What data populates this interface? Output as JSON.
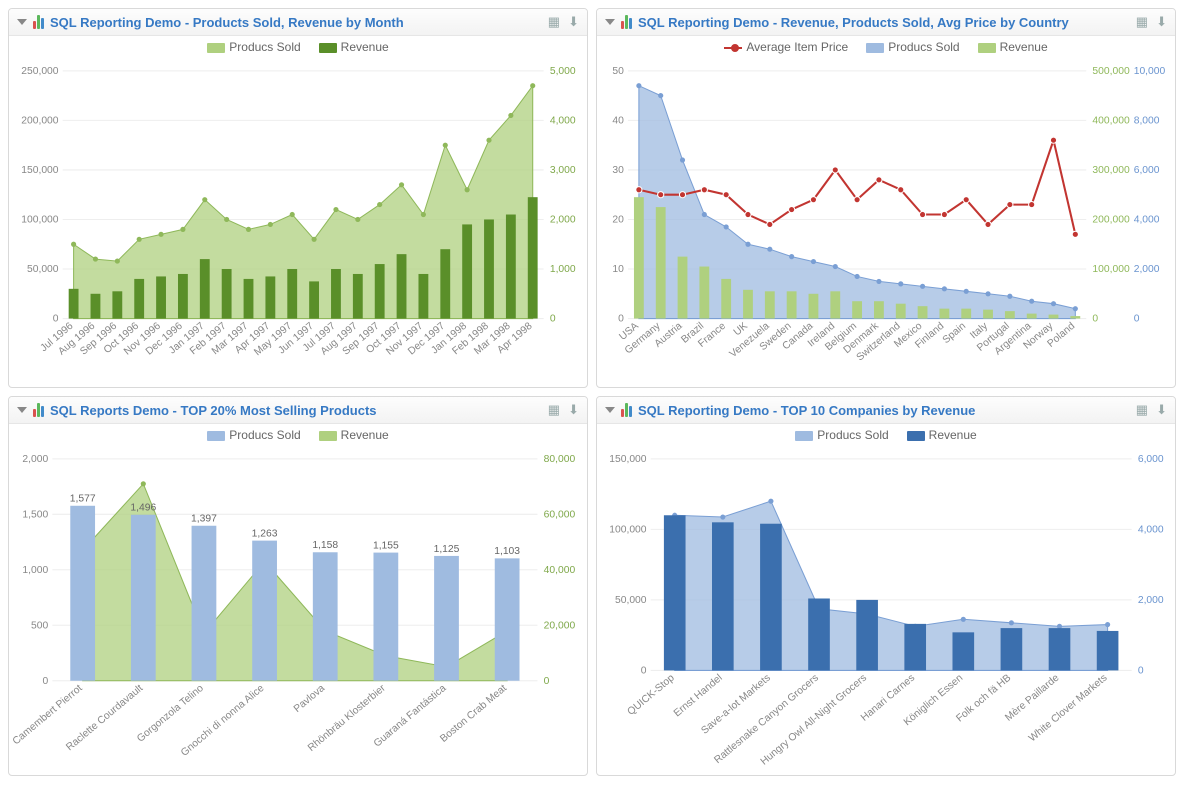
{
  "panels": [
    {
      "title": "SQL Reporting Demo - Products Sold, Revenue by Month"
    },
    {
      "title": "SQL Reporting Demo - Revenue, Products Sold, Avg Price by Country"
    },
    {
      "title": "SQL Reports Demo - TOP 20% Most Selling Products"
    },
    {
      "title": "SQL Reporting Demo - TOP 10 Companies by Revenue"
    }
  ],
  "legend_labels": {
    "products_sold": "Producs Sold",
    "revenue": "Revenue",
    "avg_price": "Average Item Price"
  },
  "colors": {
    "green_bar": "#5a8f29",
    "green_area": "#afd07f",
    "blue_bar": "#3b6fae",
    "blue_area": "#9fbbe0",
    "red_line": "#c23531"
  },
  "chart_data": [
    {
      "id": "revenue_by_month",
      "type": "bar+area",
      "categories": [
        "Jul 1996",
        "Aug 1996",
        "Sep 1996",
        "Oct 1996",
        "Nov 1996",
        "Dec 1996",
        "Jan 1997",
        "Feb 1997",
        "Mar 1997",
        "Apr 1997",
        "May 1997",
        "Jun 1997",
        "Jul 1997",
        "Aug 1997",
        "Sep 1997",
        "Oct 1997",
        "Nov 1997",
        "Dec 1997",
        "Jan 1998",
        "Feb 1998",
        "Mar 1998",
        "Apr 1998"
      ],
      "series": [
        {
          "name": "Producs Sold",
          "role": "area",
          "axis": "left",
          "values": [
            75000,
            60000,
            58000,
            80000,
            85000,
            90000,
            120000,
            100000,
            90000,
            95000,
            105000,
            80000,
            110000,
            100000,
            115000,
            135000,
            105000,
            175000,
            130000,
            180000,
            205000,
            235000
          ]
        },
        {
          "name": "Revenue",
          "role": "bar",
          "axis": "right",
          "values": [
            600,
            500,
            550,
            800,
            850,
            900,
            1200,
            1000,
            800,
            850,
            1000,
            750,
            1000,
            900,
            1100,
            1300,
            900,
            1400,
            1900,
            2000,
            2100,
            2450
          ]
        }
      ],
      "y_left": {
        "min": 0,
        "max": 250000,
        "ticks": [
          0,
          50000,
          100000,
          150000,
          200000,
          250000
        ]
      },
      "y_right": {
        "min": 0,
        "max": 5000,
        "ticks": [
          0,
          1000,
          2000,
          3000,
          4000,
          5000
        ]
      }
    },
    {
      "id": "by_country",
      "type": "bar+area+line",
      "categories": [
        "USA",
        "Germany",
        "Austria",
        "Brazil",
        "France",
        "UK",
        "Venezuela",
        "Sweden",
        "Canada",
        "Ireland",
        "Belgium",
        "Denmark",
        "Switzerland",
        "Mexico",
        "Finland",
        "Spain",
        "Italy",
        "Portugal",
        "Argentina",
        "Norway",
        "Poland"
      ],
      "series": [
        {
          "name": "Producs Sold",
          "role": "area",
          "axis": "right_blue",
          "values": [
            9400,
            9000,
            6400,
            4200,
            3700,
            3000,
            2800,
            2500,
            2300,
            2100,
            1700,
            1500,
            1400,
            1300,
            1200,
            1100,
            1000,
            900,
            700,
            600,
            400
          ]
        },
        {
          "name": "Revenue",
          "role": "bar",
          "axis": "right_green",
          "values": [
            245000,
            225000,
            125000,
            105000,
            80000,
            58000,
            55000,
            55000,
            50000,
            55000,
            35000,
            35000,
            30000,
            25000,
            20000,
            20000,
            18000,
            15000,
            10000,
            8000,
            5000
          ]
        },
        {
          "name": "Average Item Price",
          "role": "line",
          "axis": "left",
          "values": [
            26,
            25,
            25,
            26,
            25,
            21,
            19,
            22,
            24,
            30,
            24,
            28,
            26,
            21,
            21,
            24,
            19,
            23,
            23,
            36,
            17
          ]
        }
      ],
      "y_left": {
        "min": 0,
        "max": 50,
        "ticks": [
          0,
          10,
          20,
          30,
          40,
          50
        ]
      },
      "y_right_green": {
        "min": 0,
        "max": 500000,
        "ticks": [
          0,
          100000,
          200000,
          300000,
          400000,
          500000
        ]
      },
      "y_right_blue": {
        "min": 0,
        "max": 10000,
        "ticks": [
          0,
          2000,
          4000,
          6000,
          8000,
          10000
        ]
      }
    },
    {
      "id": "top_products",
      "type": "bar+area",
      "categories": [
        "Camembert Pierrot",
        "Raclette Courdavault",
        "Gorgonzola Telino",
        "Gnocchi di nonna Alice",
        "Pavlova",
        "Rhönbräu Klosterbier",
        "Guaraná Fantástica",
        "Boston Crab Meat"
      ],
      "series": [
        {
          "name": "Producs Sold",
          "role": "bar",
          "axis": "left",
          "values": [
            1577,
            1496,
            1397,
            1263,
            1158,
            1155,
            1125,
            1103
          ],
          "show_labels": true
        },
        {
          "name": "Revenue",
          "role": "area",
          "axis": "right",
          "values": [
            47000,
            71000,
            17000,
            43000,
            18000,
            9000,
            5000,
            18000
          ]
        }
      ],
      "y_left": {
        "min": 0,
        "max": 2000,
        "ticks": [
          0,
          500,
          1000,
          1500,
          2000
        ]
      },
      "y_right": {
        "min": 0,
        "max": 80000,
        "ticks": [
          0,
          20000,
          40000,
          60000,
          80000
        ]
      }
    },
    {
      "id": "top_companies",
      "type": "bar+area",
      "categories": [
        "QUICK-Stop",
        "Ernst Handel",
        "Save-a-lot Markets",
        "Rattlesnake Canyon Grocers",
        "Hungry Owl All-Night Grocers",
        "Hanari Carnes",
        "Königlich Essen",
        "Folk och fä HB",
        "Mère Paillarde",
        "White Clover Markets"
      ],
      "series": [
        {
          "name": "Producs Sold",
          "role": "area",
          "axis": "right",
          "values": [
            4400,
            4350,
            4800,
            1750,
            1600,
            1250,
            1450,
            1350,
            1250,
            1300
          ]
        },
        {
          "name": "Revenue",
          "role": "bar",
          "axis": "left",
          "values": [
            110000,
            105000,
            104000,
            51000,
            50000,
            33000,
            27000,
            30000,
            30000,
            28000
          ]
        }
      ],
      "y_left": {
        "min": 0,
        "max": 150000,
        "ticks": [
          0,
          50000,
          100000,
          150000
        ]
      },
      "y_right": {
        "min": 0,
        "max": 6000,
        "ticks": [
          0,
          2000,
          4000,
          6000
        ]
      }
    }
  ]
}
